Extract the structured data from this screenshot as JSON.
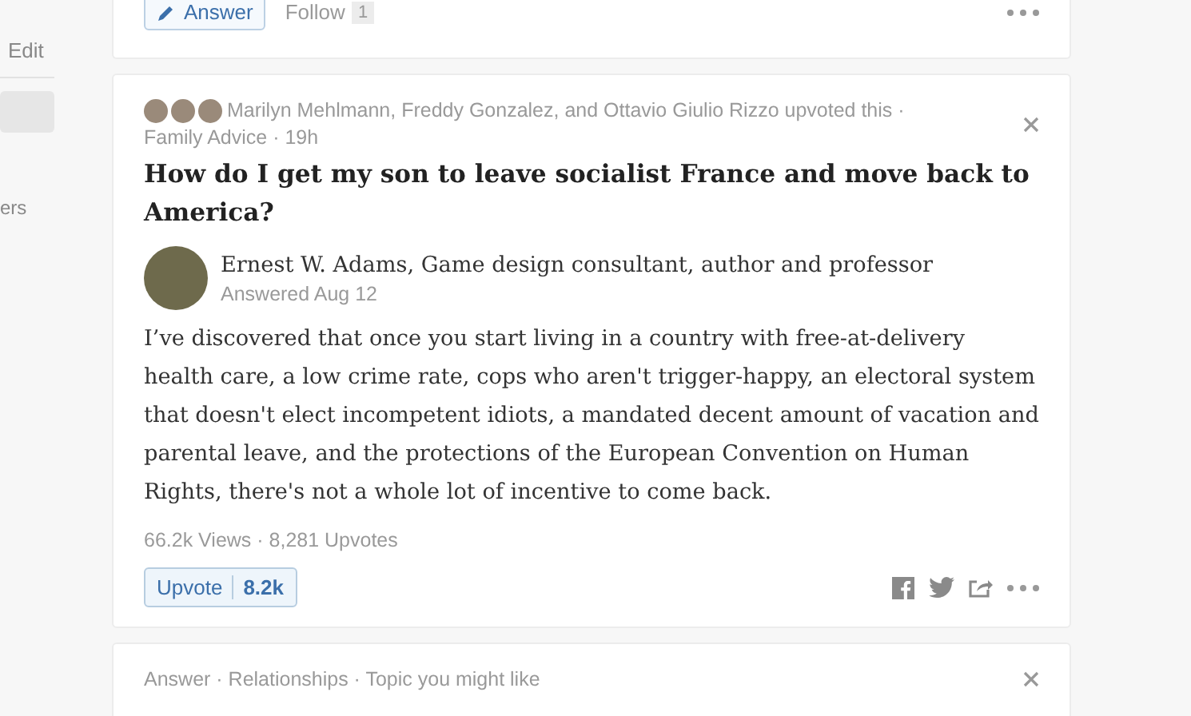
{
  "sidebar": {
    "items": [
      {
        "label": "Edit",
        "selected": false
      },
      {
        "selected": true
      },
      {
        "label": "ers",
        "selected": false
      }
    ]
  },
  "feed": [
    {
      "kind": "actions",
      "answer_button": "Answer",
      "follow_label": "Follow",
      "follow_count": "1"
    },
    {
      "kind": "answer",
      "upvoters": "Marilyn Mehlmann, Freddy Gonzalez, and Ottavio Giulio Rizzo upvoted this ·",
      "upvoter_avatars": [
        {
          "kind": "photo"
        },
        {
          "kind": "photo"
        },
        {
          "kind": "photo"
        }
      ],
      "topic": "Family Advice · 19h",
      "question": "How do I get my son to leave socialist France and move back to America?",
      "author": "Ernest W. Adams, Game design consultant, author and professor",
      "answered": "Answered Aug 12",
      "body": "I’ve discovered that once you start living in a country with free-at-delivery health care, a low crime rate, cops who aren't trigger-happy, an electoral system that doesn't elect incompetent idiots, a mandated decent amount of vacation and parental leave, and the protections of the European Convention on Human Rights, there's not a whole lot of incentive to come back.",
      "stats": "66.2k Views · 8,281 Upvotes",
      "upvote_label": "Upvote",
      "upvote_count": "8.2k"
    },
    {
      "kind": "header",
      "meta": "Answer · Relationships · Topic you might like"
    }
  ]
}
